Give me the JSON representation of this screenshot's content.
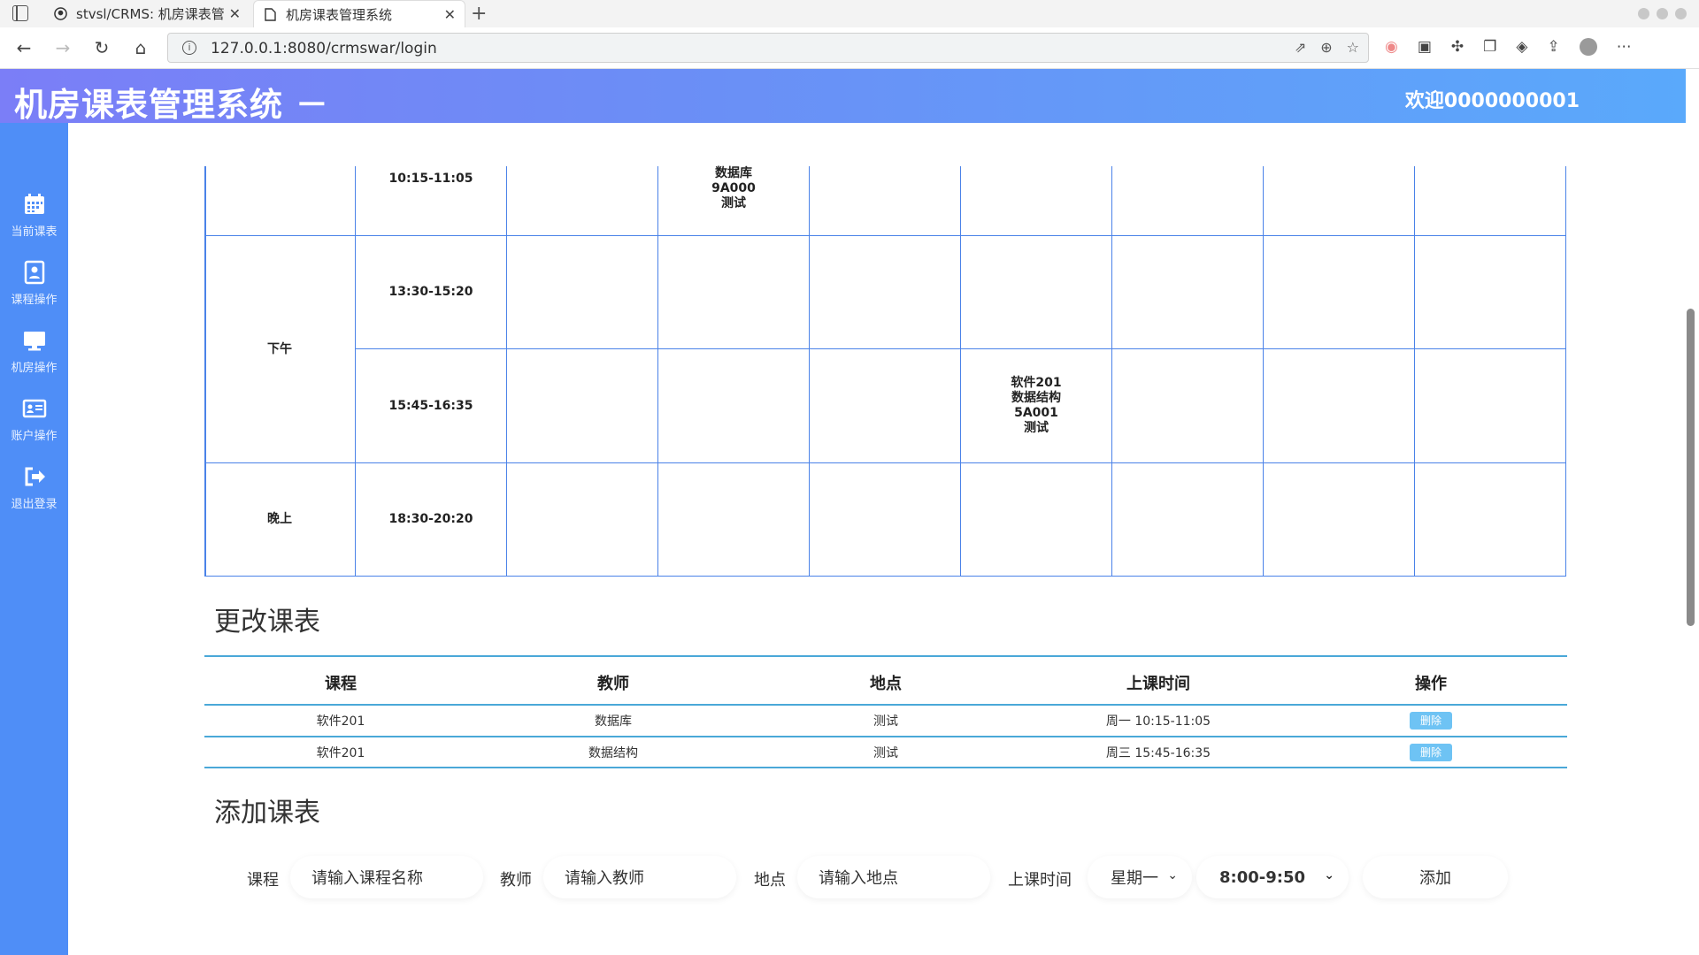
{
  "browser": {
    "tabs": [
      {
        "label": "stvsl/CRMS: 机房课表管理系",
        "icon": "github-icon"
      },
      {
        "label": "机房课表管理系统",
        "icon": "page-icon"
      }
    ],
    "url": "127.0.0.1:8080/crmswar/login"
  },
  "header": {
    "title": "机房课表管理系统 －",
    "welcome": "欢迎0000000001"
  },
  "sidebar": {
    "items": [
      {
        "label": "当前课表",
        "icon": "calendar-icon"
      },
      {
        "label": "课程操作",
        "icon": "contact-book-icon"
      },
      {
        "label": "机房操作",
        "icon": "monitor-icon"
      },
      {
        "label": "账户操作",
        "icon": "id-card-icon"
      },
      {
        "label": "退出登录",
        "icon": "logout-icon"
      }
    ]
  },
  "timetable": {
    "periods": [
      "下午",
      "晚上"
    ],
    "times": [
      "10:15-11:05",
      "13:30-15:20",
      "15:45-16:35",
      "18:30-20:20"
    ],
    "entries": {
      "r0c1": "数据库\n9A000\n测试",
      "r2c3": "软件201\n数据结构\n5A001\n测试"
    }
  },
  "change_section": {
    "title": "更改课表",
    "headers": [
      "课程",
      "教师",
      "地点",
      "上课时间",
      "操作"
    ],
    "rows": [
      {
        "course": "软件201",
        "teacher": "数据库",
        "place": "测试",
        "time": "周一 10:15-11:05",
        "action": "删除"
      },
      {
        "course": "软件201",
        "teacher": "数据结构",
        "place": "测试",
        "time": "周三 15:45-16:35",
        "action": "删除"
      }
    ]
  },
  "add_section": {
    "title": "添加课表",
    "course_label": "课程",
    "course_placeholder": "请输入课程名称",
    "teacher_label": "教师",
    "teacher_placeholder": "请输入教师",
    "place_label": "地点",
    "place_placeholder": "请输入地点",
    "time_label": "上课时间",
    "weekday_selected": "星期一",
    "slot_selected": "8:00-9:50",
    "add_label": "添加"
  }
}
